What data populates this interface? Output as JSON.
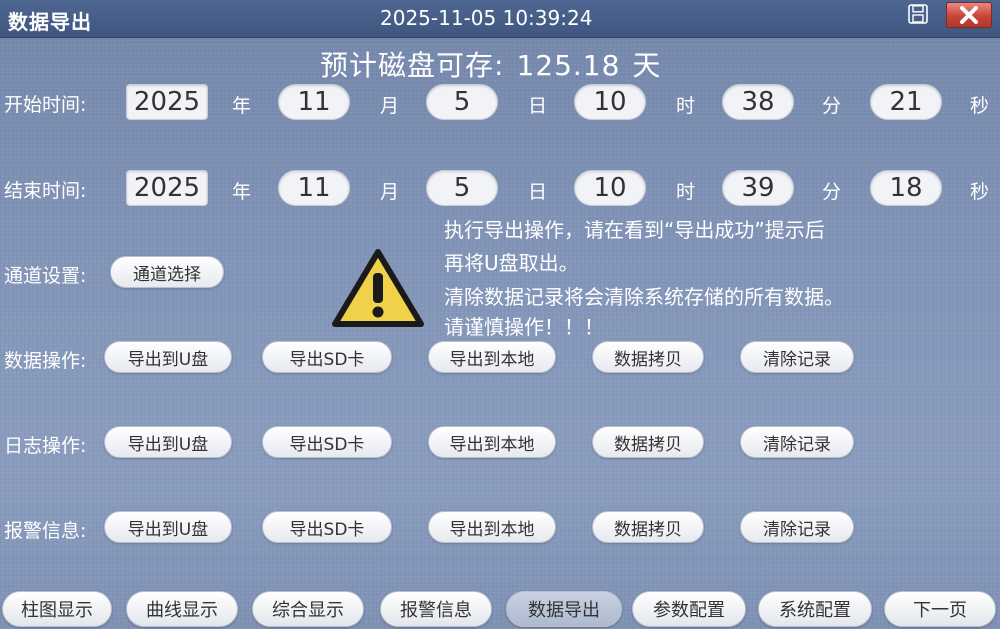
{
  "titlebar": {
    "title": "数据导出",
    "datetime": "2025-11-05  10:39:24",
    "save_icon": "save-icon",
    "close_icon": "close-icon",
    "close_color": "#c8453a"
  },
  "disk": {
    "label": "预计磁盘可存:",
    "value": "125.18",
    "unit": "天"
  },
  "start_time": {
    "label": "开始时间:",
    "year": "2025",
    "year_unit": "年",
    "month": "11",
    "month_unit": "月",
    "day": "5",
    "day_unit": "日",
    "hour": "10",
    "hour_unit": "时",
    "minute": "38",
    "minute_unit": "分",
    "second": "21",
    "second_unit": "秒"
  },
  "end_time": {
    "label": "结束时间:",
    "year": "2025",
    "year_unit": "年",
    "month": "11",
    "month_unit": "月",
    "day": "5",
    "day_unit": "日",
    "hour": "10",
    "hour_unit": "时",
    "minute": "39",
    "minute_unit": "分",
    "second": "18",
    "second_unit": "秒"
  },
  "channel": {
    "label": "通道设置:",
    "button": "通道选择"
  },
  "warning": {
    "icon": "warning-icon",
    "lines": [
      "执行导出操作，请在看到“导出成功”提示后",
      "再将U盘取出。",
      "清除数据记录将会清除系统存储的所有数据。",
      "请谨慎操作！！！"
    ]
  },
  "ops": [
    {
      "label": "数据操作:",
      "buttons": [
        "导出到U盘",
        "导出SD卡",
        "导出到本地",
        "数据拷贝",
        "清除记录"
      ]
    },
    {
      "label": "日志操作:",
      "buttons": [
        "导出到U盘",
        "导出SD卡",
        "导出到本地",
        "数据拷贝",
        "清除记录"
      ]
    },
    {
      "label": "报警信息:",
      "buttons": [
        "导出到U盘",
        "导出SD卡",
        "导出到本地",
        "数据拷贝",
        "清除记录"
      ]
    }
  ],
  "nav": {
    "items": [
      "柱图显示",
      "曲线显示",
      "综合显示",
      "报警信息",
      "数据导出",
      "参数配置",
      "系统配置",
      "下一页"
    ],
    "active": "数据导出"
  },
  "colors": {
    "background": "#8295b8",
    "titlebar": "#4e6691",
    "warning_fill": "#f0d24a"
  }
}
